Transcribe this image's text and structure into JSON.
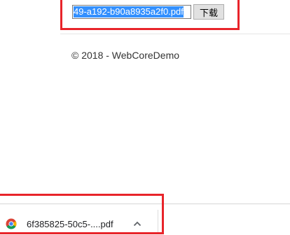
{
  "upload_form": {
    "file_value": "49-a192-b90a8935a2f0.pdf",
    "button_label": "下载"
  },
  "footer": {
    "text": "© 2018 - WebCoreDemo"
  },
  "download_bar": {
    "items": [
      {
        "filename": "6f385825-50c5-....pdf",
        "icon": "chrome-icon"
      }
    ],
    "chevron_icon": "chevron-up-icon"
  },
  "highlight_color": "#e8242a",
  "selection_color": "#3390ff"
}
